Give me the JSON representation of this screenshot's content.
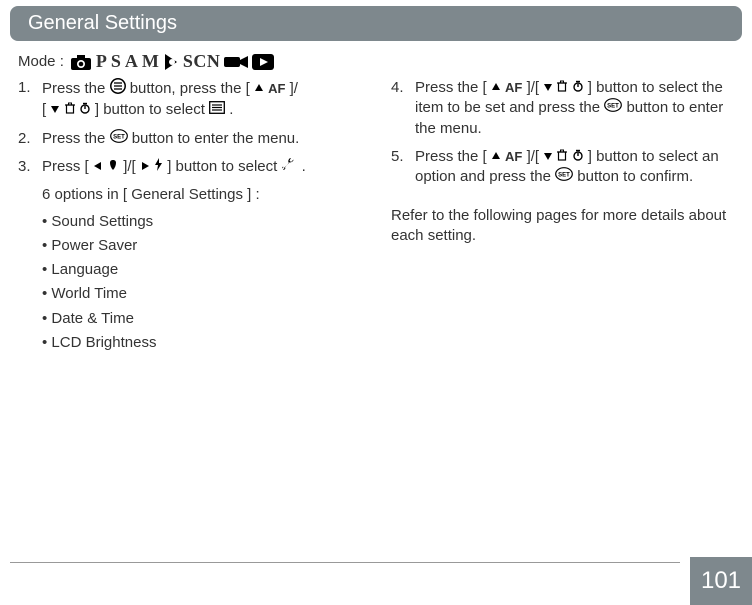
{
  "header": {
    "title": "General Settings"
  },
  "mode": {
    "label": "Mode :"
  },
  "mode_icons": {
    "camera": "camera-icon",
    "p": "P",
    "s": "S",
    "a": "A",
    "m": "M",
    "portrait": "portrait-icon",
    "scn": "SCN",
    "video": "video-icon",
    "play": "play-icon"
  },
  "left": {
    "step1": {
      "num": "1.",
      "t1": "Press the ",
      "t2": " button, press the [ ",
      "af": "AF",
      "t3": " ]/",
      "t4": "[ ",
      "t5": " ] button to select ",
      "t6": " ."
    },
    "step2": {
      "num": "2.",
      "t1": "Press the ",
      "set": "SET",
      "t2": " button to enter the menu."
    },
    "step3": {
      "num": "3.",
      "t1": "Press [ ",
      "t2": " ]/[ ",
      "t3": " ] button to select ",
      "t4": " ."
    },
    "intro": "6 options in [ General Settings ] :",
    "bullets": [
      "Sound Settings",
      "Power Saver",
      "Language",
      "World Time",
      "Date & Time",
      "LCD Brightness"
    ]
  },
  "right": {
    "step4": {
      "num": "4.",
      "t1": "Press the [ ",
      "af": "AF",
      "t2": " ]/[ ",
      "t3": " ] button to select the item to be set and press the ",
      "set": "SET",
      "t4": " button to enter the menu."
    },
    "step5": {
      "num": "5.",
      "t1": "Press the [ ",
      "af": "AF",
      "t2": " ]/[ ",
      "t3": " ] button to select an option and press the ",
      "set": "SET",
      "t4": " button to confirm."
    },
    "reference": "Refer to the following pages for more details about each setting."
  },
  "page_number": "101"
}
